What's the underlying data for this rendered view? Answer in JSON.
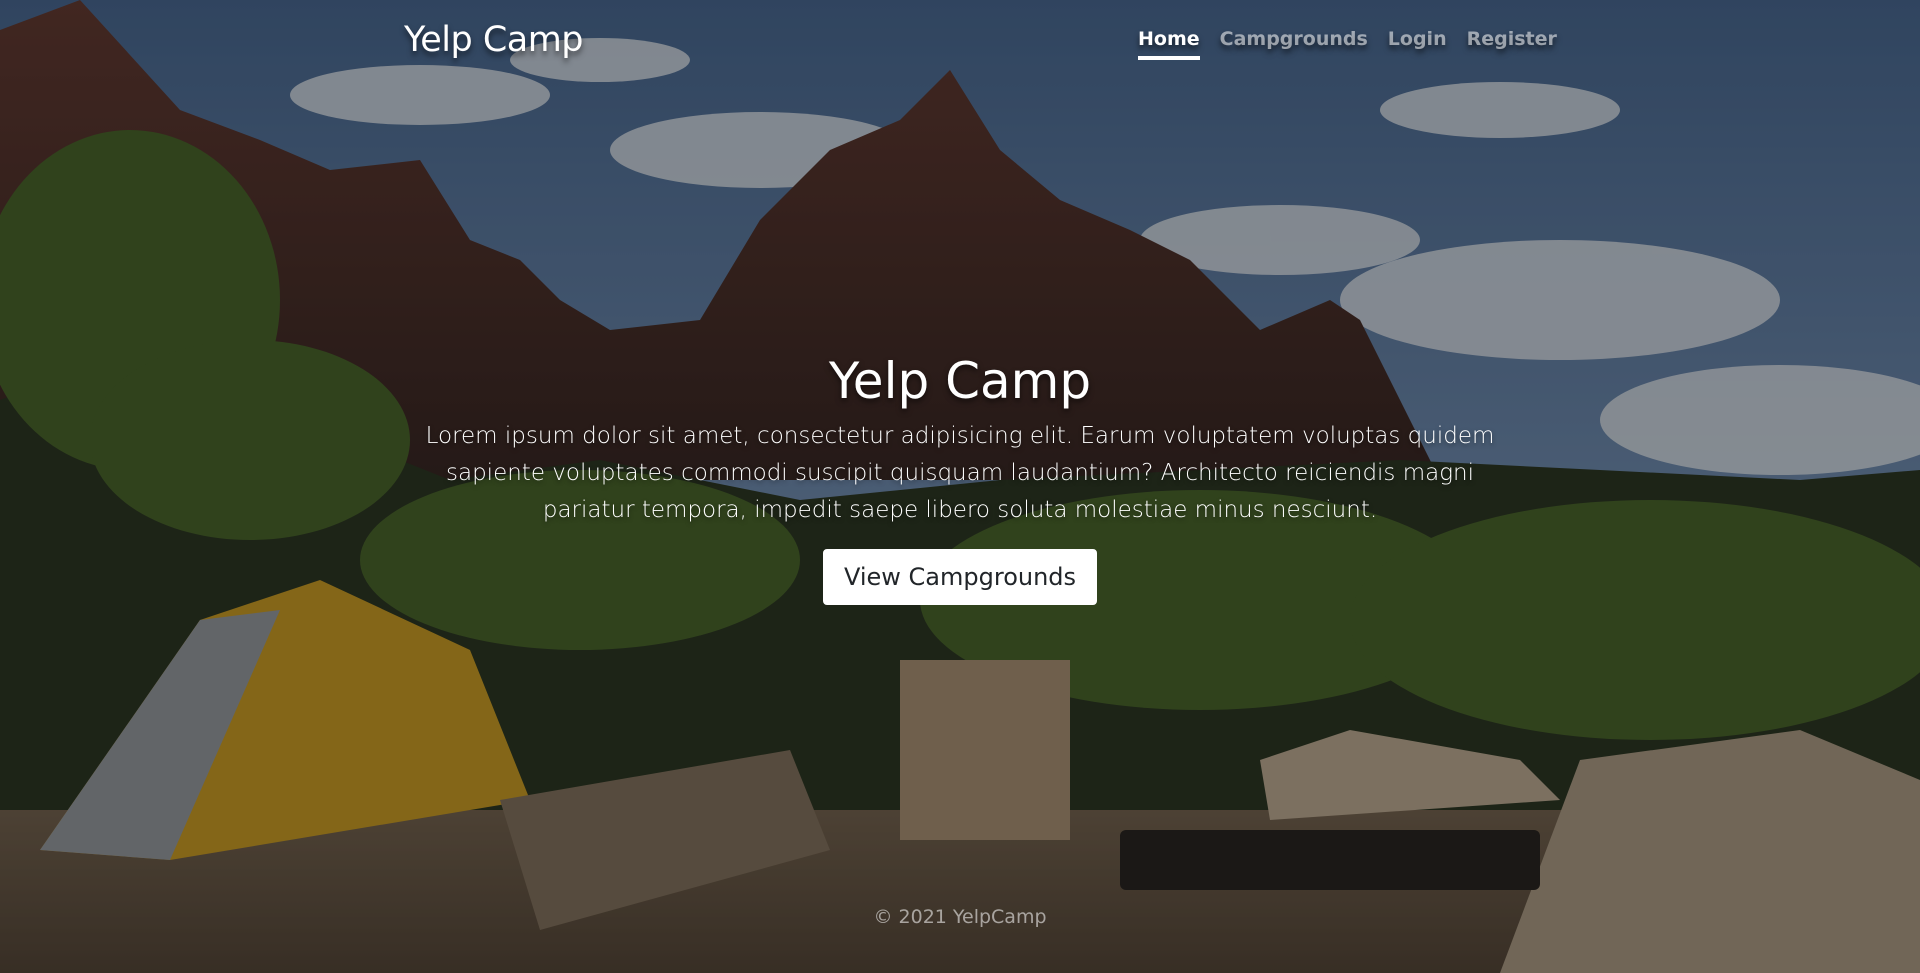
{
  "navbar": {
    "brand": "Yelp Camp",
    "links": [
      {
        "label": "Home",
        "active": true
      },
      {
        "label": "Campgrounds",
        "active": false
      },
      {
        "label": "Login",
        "active": false
      },
      {
        "label": "Register",
        "active": false
      }
    ]
  },
  "hero": {
    "title": "Yelp Camp",
    "lead": "Lorem ipsum dolor sit amet, consectetur adipisicing elit. Earum voluptatem voluptas quidem sapiente voluptates commodi suscipit quisquam laudantium? Architecto reiciendis magni pariatur tempora, impedit saepe libero soluta molestiae minus nesciunt.",
    "button_label": "View Campgrounds"
  },
  "footer": {
    "text": "© 2021 YelpCamp"
  },
  "background": {
    "description_icon": "campsite-photo"
  }
}
